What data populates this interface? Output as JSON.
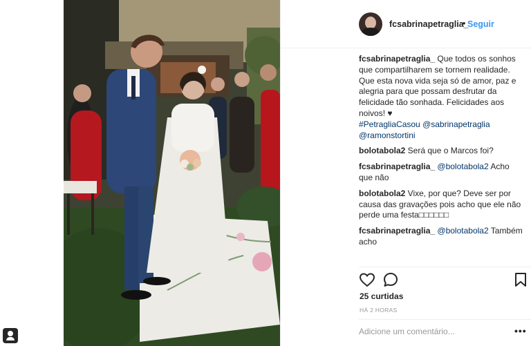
{
  "header": {
    "username": "fcsabrinapetraglia_",
    "separator": "•",
    "follow_label": "Seguir"
  },
  "comments": [
    {
      "user": "fcsabrinapetraglia_",
      "text": " Que todos os sonhos que compartilharem se tornem realidade. Que esta nova vida seja só de amor, paz e alegria para que possam desfrutar da felicidade tão sonhada. Felicidades aos noivos! ♥",
      "tags": [
        "#PetragliaCasou",
        "@sabrinapetraglia",
        "@ramonstortini"
      ]
    },
    {
      "user": "bolotabola2",
      "text": " Será que o Marcos foi?"
    },
    {
      "user": "fcsabrinapetraglia_",
      "mention": "@bolotabola2",
      "text": " Acho que não"
    },
    {
      "user": "bolotabola2",
      "text": " Vixe, por que? Deve ser por causa das gravações pois acho que ele não perde uma festa□□□□□□"
    },
    {
      "user": "fcsabrinapetraglia_",
      "mention": "@bolotabola2",
      "text": " Também acho"
    }
  ],
  "actions": {
    "like_icon": "heart-outline-icon",
    "comment_icon": "speech-bubble-icon",
    "save_icon": "bookmark-icon"
  },
  "likes": "25 curtidas",
  "time": "HÁ 2 HORAS",
  "add_comment_placeholder": "Adicione um comentário...",
  "more_label": "•••",
  "colors": {
    "link_blue": "#3897f0",
    "hashtag": "#003569",
    "muted": "#999999",
    "text": "#262626"
  }
}
